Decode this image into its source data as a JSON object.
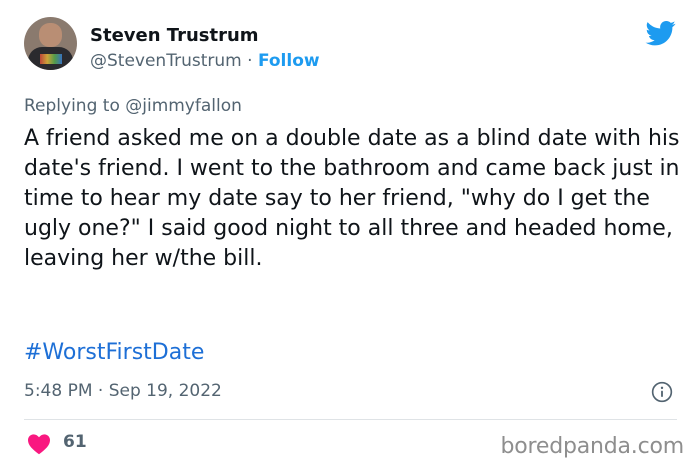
{
  "author": {
    "name": "Steven Trustrum",
    "handle": "@StevenTrustrum",
    "separator": " · ",
    "follow_label": "Follow"
  },
  "icons": {
    "platform": "twitter-bird-icon",
    "info": "info-icon",
    "like": "heart-icon"
  },
  "reply_context": "Replying to @jimmyfallon",
  "tweet": {
    "text": "A friend asked me on a double date as a blind date with his date's friend. I went to the bathroom and came back just in time to hear my date say to her friend, \"why do I get the ugly one?\" I said good night to all three and headed home, leaving her w/the bill.",
    "hashtag": "#WorstFirstDate",
    "timestamp": "5:48 PM · Sep 19, 2022"
  },
  "engagement": {
    "likes": "61"
  },
  "watermark": "boredpanda.com",
  "colors": {
    "accent": "#1d9bf0",
    "hashtag": "#1d6fd6",
    "heart": "#f91880",
    "muted": "#536471"
  }
}
